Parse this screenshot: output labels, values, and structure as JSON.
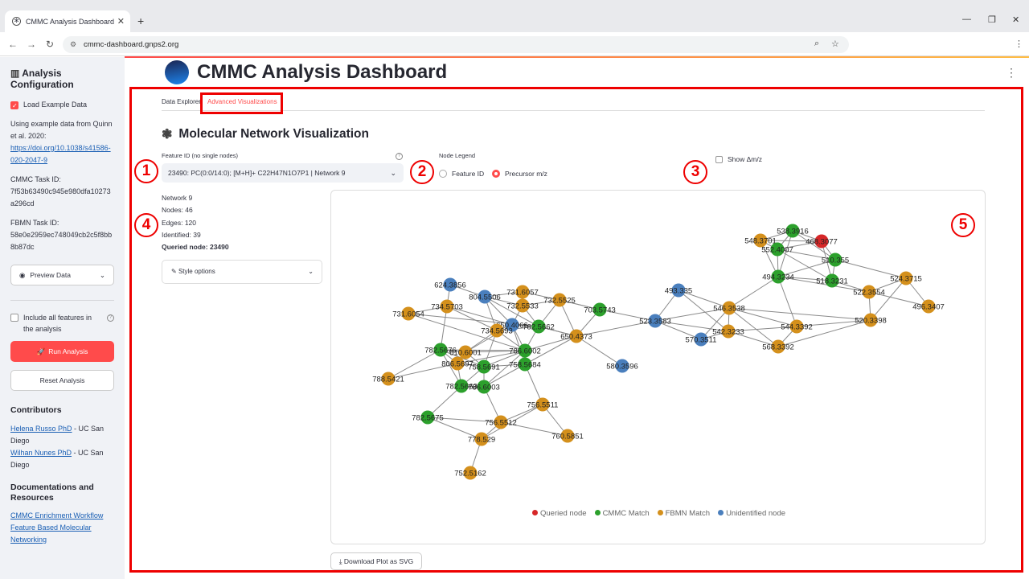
{
  "browser": {
    "tab_title": "CMMC Analysis Dashboard",
    "url": "cmmc-dashboard.gnps2.org"
  },
  "sidebar": {
    "title": "Analysis Configuration",
    "load_example_label": "Load Example Data",
    "example_text": "Using example data from Quinn et al. 2020:",
    "example_link": "https://doi.org/10.1038/s41586-020-2047-9",
    "cmmc_task_label": "CMMC Task ID:",
    "cmmc_task_id": "7f53b63490c945e980dfa10273a296cd",
    "fbmn_task_label": "FBMN Task ID:",
    "fbmn_task_id": "58e0e2959ec748049cb2c5f8bb8b87dc",
    "preview_label": "Preview Data",
    "include_all_label": "Include all features in the analysis",
    "run_label": "Run Analysis",
    "reset_label": "Reset Analysis",
    "contributors_heading": "Contributors",
    "contributors": [
      {
        "name": "Helena Russo PhD",
        "affil": " - UC San Diego"
      },
      {
        "name": "Wilhan Nunes PhD",
        "affil": " - UC San Diego"
      }
    ],
    "docs_heading": "Documentations and Resources",
    "docs_links": [
      "CMMC Enrichment Workflow",
      "Feature Based Molecular Networking"
    ]
  },
  "main": {
    "title": "CMMC Analysis Dashboard",
    "tabs": [
      "Data Explorer",
      "Advanced Visualizations"
    ],
    "section_title": "Molecular Network Visualization",
    "feature_label": "Feature ID (no single nodes)",
    "feature_value": "23490: PC(0:0/14:0); [M+H]+ C22H47N1O7P1 | Network 9",
    "legend_label": "Node Legend",
    "legend_options": [
      "Feature ID",
      "Precursor m/z"
    ],
    "show_dmz_label": "Show Δm/z",
    "stats": {
      "network": "Network 9",
      "nodes": "Nodes: 46",
      "edges": "Edges: 120",
      "identified": "Identified: 39",
      "queried": "Queried node: 23490"
    },
    "style_options_label": "Style options",
    "download_label": "Download Plot as SVG",
    "badges": [
      "1",
      "2",
      "3",
      "4",
      "5"
    ]
  },
  "network": {
    "colors": {
      "queried": "#d62728",
      "cmmc": "#2ca02c",
      "fbmn": "#d4901c",
      "unidentified": "#4a7fbd"
    },
    "legend": [
      {
        "key": "queried",
        "label": "Queried node"
      },
      {
        "key": "cmmc",
        "label": "CMMC Match"
      },
      {
        "key": "fbmn",
        "label": "FBMN Match"
      },
      {
        "key": "unidentified",
        "label": "Unidentified node"
      }
    ],
    "nodes": [
      {
        "id": "538.3916",
        "type": "cmmc"
      },
      {
        "id": "548.3701",
        "type": "fbmn"
      },
      {
        "id": "468.3077",
        "type": "queried"
      },
      {
        "id": "552.4007",
        "type": "cmmc"
      },
      {
        "id": "510.355",
        "type": "cmmc"
      },
      {
        "id": "494.3234",
        "type": "cmmc"
      },
      {
        "id": "518.3231",
        "type": "cmmc"
      },
      {
        "id": "524.3715",
        "type": "fbmn"
      },
      {
        "id": "522.3554",
        "type": "fbmn"
      },
      {
        "id": "496.3407",
        "type": "fbmn"
      },
      {
        "id": "493.335",
        "type": "unidentified"
      },
      {
        "id": "546.3538",
        "type": "fbmn"
      },
      {
        "id": "520.3398",
        "type": "fbmn"
      },
      {
        "id": "544.3392",
        "type": "fbmn"
      },
      {
        "id": "523.3583",
        "type": "unidentified"
      },
      {
        "id": "542.3233",
        "type": "fbmn"
      },
      {
        "id": "570.3511",
        "type": "unidentified"
      },
      {
        "id": "568.3392",
        "type": "fbmn"
      },
      {
        "id": "624.3856",
        "type": "unidentified"
      },
      {
        "id": "804.5506",
        "type": "unidentified"
      },
      {
        "id": "731.6057",
        "type": "fbmn"
      },
      {
        "id": "732.5525",
        "type": "fbmn"
      },
      {
        "id": "734.5703",
        "type": "fbmn"
      },
      {
        "id": "732.5533",
        "type": "fbmn"
      },
      {
        "id": "703.5743",
        "type": "cmmc"
      },
      {
        "id": "731.6054",
        "type": "fbmn"
      },
      {
        "id": "650.4066",
        "type": "unidentified"
      },
      {
        "id": "782.5662",
        "type": "cmmc"
      },
      {
        "id": "734.5693",
        "type": "fbmn"
      },
      {
        "id": "650.4373",
        "type": "fbmn"
      },
      {
        "id": "782.5676",
        "type": "cmmc"
      },
      {
        "id": "810.6001",
        "type": "fbmn"
      },
      {
        "id": "786.6002",
        "type": "cmmc"
      },
      {
        "id": "806.5697",
        "type": "fbmn"
      },
      {
        "id": "758.5691",
        "type": "cmmc"
      },
      {
        "id": "758.5684",
        "type": "cmmc"
      },
      {
        "id": "580.3596",
        "type": "unidentified"
      },
      {
        "id": "788.5421",
        "type": "fbmn"
      },
      {
        "id": "782.5663",
        "type": "cmmc"
      },
      {
        "id": "786.6003",
        "type": "cmmc"
      },
      {
        "id": "756.5511",
        "type": "fbmn"
      },
      {
        "id": "782.5675",
        "type": "cmmc"
      },
      {
        "id": "756.5512",
        "type": "fbmn"
      },
      {
        "id": "760.5851",
        "type": "fbmn"
      },
      {
        "id": "778.529",
        "type": "fbmn"
      },
      {
        "id": "752.5162",
        "type": "fbmn"
      }
    ]
  }
}
